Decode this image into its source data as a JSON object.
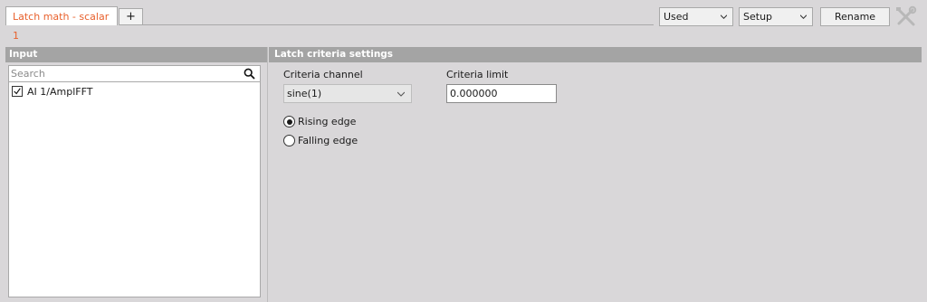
{
  "tabs": {
    "active_label": "Latch math - scalar 1",
    "add_label": "+",
    "accent_color": "#e8602c"
  },
  "toolbar": {
    "used_select": "Used",
    "setup_select": "Setup",
    "rename_label": "Rename",
    "tools_icon": "wrench-screwdriver-icon"
  },
  "input_panel": {
    "header": "Input",
    "search_placeholder": "Search",
    "search_value": "",
    "items": [
      {
        "label": "AI 1/AmplFFT",
        "checked": true
      }
    ]
  },
  "criteria_panel": {
    "header": "Latch criteria settings",
    "channel_label": "Criteria channel",
    "channel_value": "sine(1)",
    "limit_label": "Criteria limit",
    "limit_value": "0.000000",
    "edges": [
      {
        "label": "Rising edge",
        "selected": true
      },
      {
        "label": "Falling edge",
        "selected": false
      }
    ]
  }
}
